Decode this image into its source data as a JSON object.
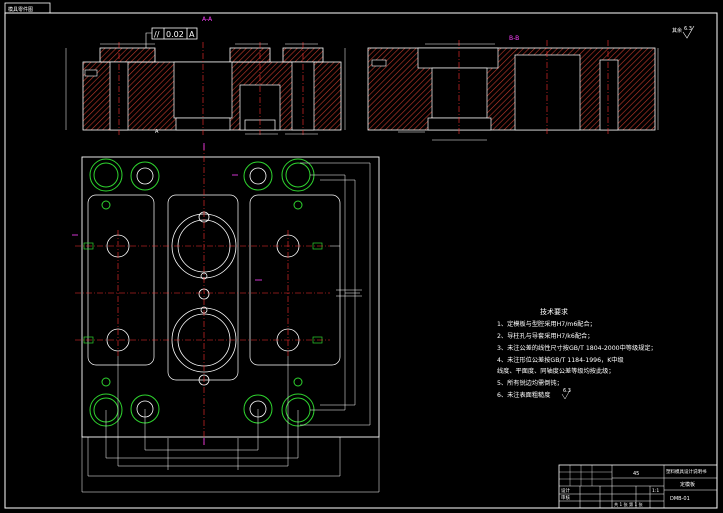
{
  "drawing": {
    "corner_label": "模具零件图",
    "section_left_label": "A-A",
    "section_right_label": "B-B",
    "roughness_label": "其余",
    "roughness_value": "6.3",
    "tolerance_frame": {
      "symbol": "//",
      "value": "0.02",
      "datum": "A"
    },
    "datum_label": "A"
  },
  "tech_requirements": {
    "title": "技术要求",
    "items": [
      "1、定模板与型腔采用H7/m6配合；",
      "2、导柱孔与导套采用H7/k6配合；",
      "3、未注公差的线性尺寸按GB/T 1804-2000中等级规定；",
      "4、未注形位公差按GB/T 1184-1996，K中级",
      "   线度、平面度、同轴度公差等级均按此级；",
      "5、所有锐边均需倒钝；",
      "6、未注表面粗糙度"
    ],
    "roughness_mark": "6.3"
  },
  "title_block": {
    "part_name": "定模板",
    "designer": "设计",
    "checker": "审核",
    "scale": "1:1",
    "sheet": "共 1 张 第 1 张",
    "material": "45",
    "school": "塑料模具设计说明书",
    "drawing_no": "DMB-01"
  },
  "colors": {
    "outline": "#ffffff",
    "hatch": "#c0392b",
    "center": "#ff3030",
    "dimension": "#ffffff",
    "green_circle": "#2fd42f",
    "section_cut": "#ff40ff",
    "tolerance_frame": "#ffffff"
  }
}
